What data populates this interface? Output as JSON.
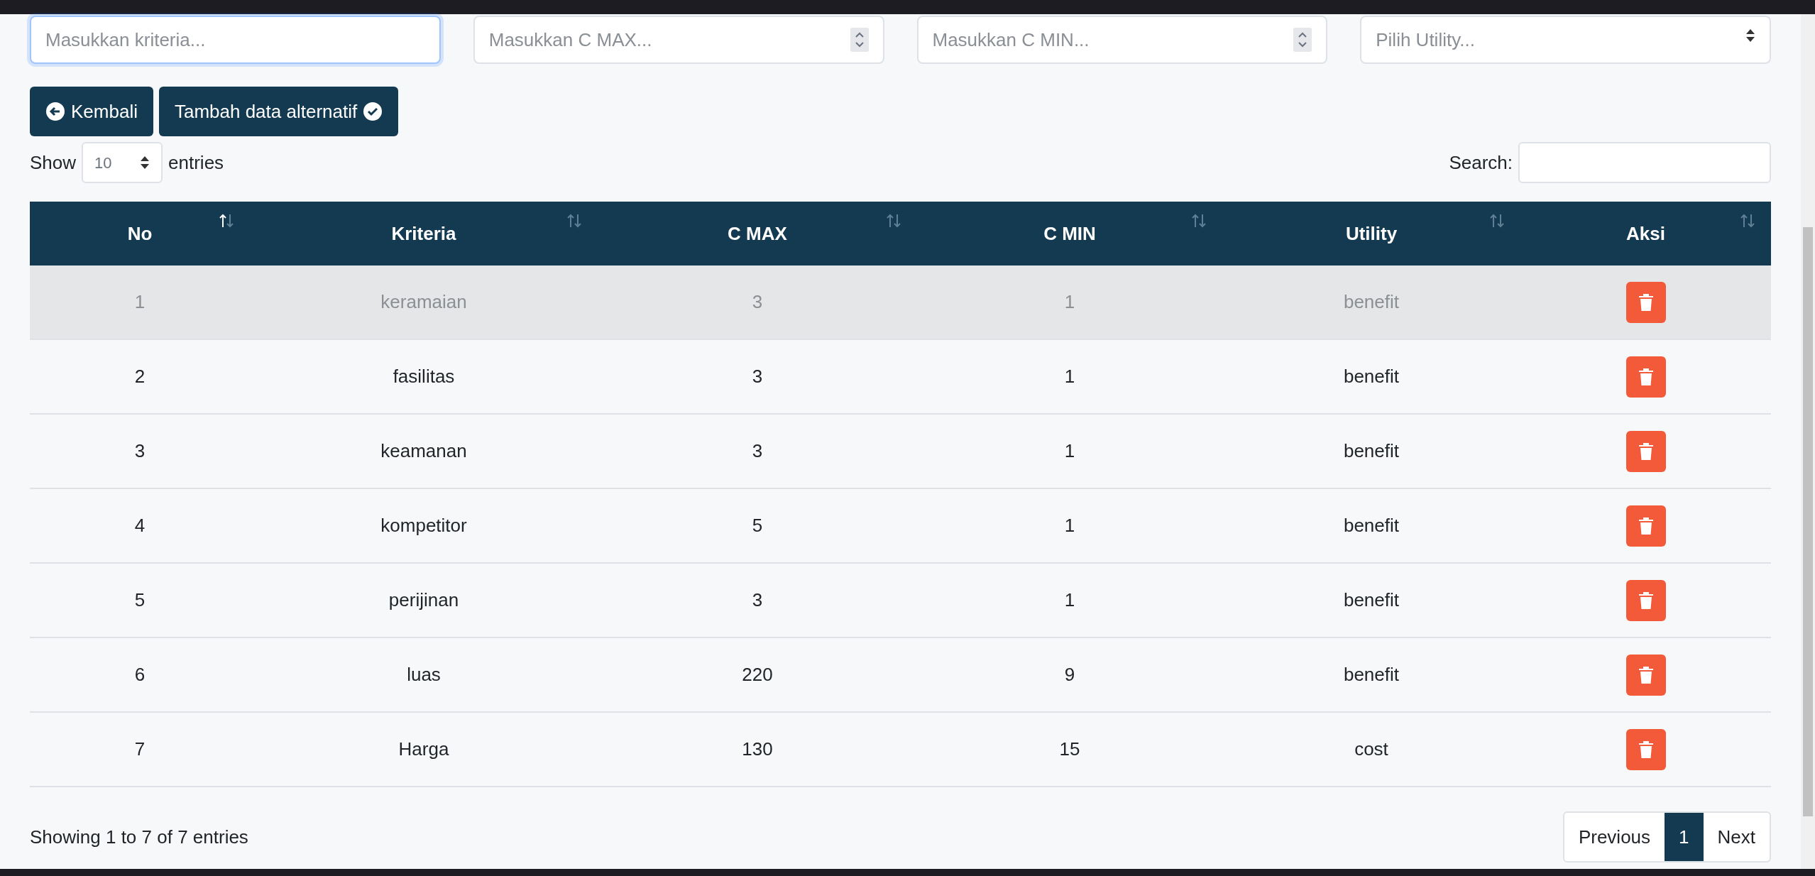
{
  "form": {
    "fields": [
      {
        "kind": "text",
        "placeholder": "Masukkan kriteria...",
        "focused": true
      },
      {
        "kind": "number",
        "placeholder": "Masukkan C MAX...",
        "focused": false
      },
      {
        "kind": "number",
        "placeholder": "Masukkan C MIN...",
        "focused": false
      },
      {
        "kind": "select",
        "placeholder": "Pilih Utility...",
        "focused": false
      }
    ],
    "buttons": [
      {
        "kind": "back",
        "label": "Kembali"
      },
      {
        "kind": "submit",
        "label": "Tambah data alternatif"
      }
    ]
  },
  "table": {
    "length": {
      "before": "Show",
      "value": "10",
      "after": "entries"
    },
    "search": {
      "label": "Search:"
    },
    "columns": [
      {
        "label": "No",
        "sorted": true
      },
      {
        "label": "Kriteria",
        "sorted": false
      },
      {
        "label": "C MAX",
        "sorted": false
      },
      {
        "label": "C MIN",
        "sorted": false
      },
      {
        "label": "Utility",
        "sorted": false
      },
      {
        "label": "Aksi",
        "sorted": false
      }
    ],
    "rows": [
      {
        "cells": [
          "1",
          "keramaian",
          "3",
          "1",
          "benefit"
        ],
        "selected": true
      },
      {
        "cells": [
          "2",
          "fasilitas",
          "3",
          "1",
          "benefit"
        ],
        "selected": false
      },
      {
        "cells": [
          "3",
          "keamanan",
          "3",
          "1",
          "benefit"
        ],
        "selected": false
      },
      {
        "cells": [
          "4",
          "kompetitor",
          "5",
          "1",
          "benefit"
        ],
        "selected": false
      },
      {
        "cells": [
          "5",
          "perijinan",
          "3",
          "1",
          "benefit"
        ],
        "selected": false
      },
      {
        "cells": [
          "6",
          "luas",
          "220",
          "9",
          "benefit"
        ],
        "selected": false
      },
      {
        "cells": [
          "7",
          "Harga",
          "130",
          "15",
          "cost"
        ],
        "selected": false
      }
    ],
    "info": "Showing 1 to 7 of 7 entries",
    "pagination": [
      {
        "label": "Previous",
        "selected": false
      },
      {
        "label": "1",
        "selected": true
      },
      {
        "label": "Next",
        "selected": false
      }
    ]
  }
}
